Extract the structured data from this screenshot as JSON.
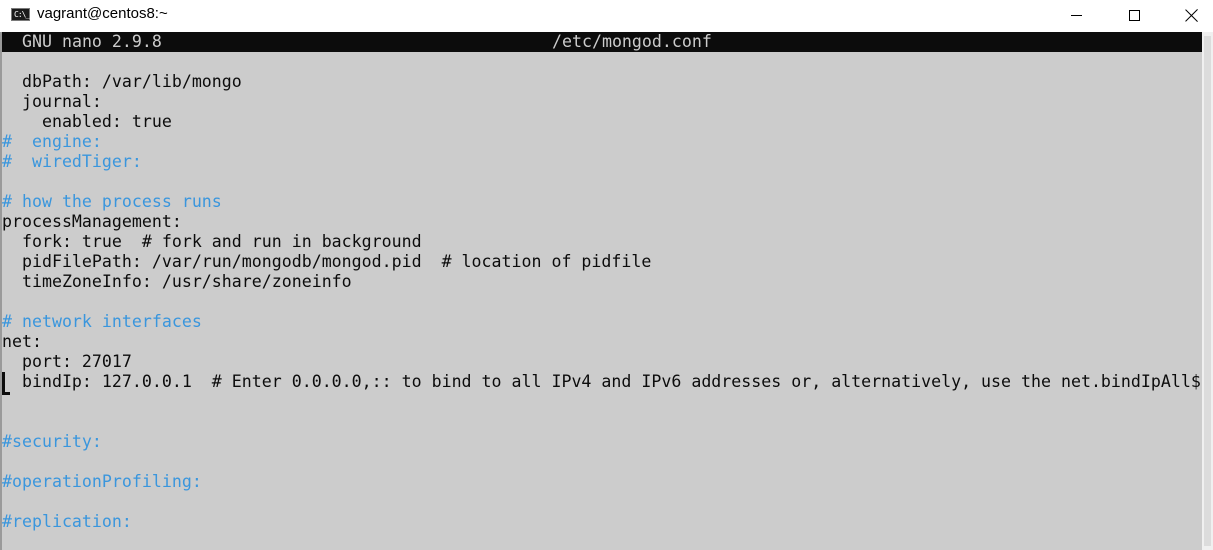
{
  "window": {
    "title": "vagrant@centos8:~",
    "icon": "console-icon",
    "icon_glyph": "C:\\_"
  },
  "nano": {
    "version": "GNU nano 2.9.8",
    "filename": "/etc/mongod.conf"
  },
  "colors": {
    "background": "#cccccc",
    "text": "#0c0c0c",
    "comment": "#3a96dd",
    "header_bg": "#0c0c0c"
  },
  "lines": [
    {
      "text": "  dbPath: /var/lib/mongo",
      "comment": false
    },
    {
      "text": "  journal:",
      "comment": false
    },
    {
      "text": "    enabled: true",
      "comment": false
    },
    {
      "text": "#  engine:",
      "comment": true
    },
    {
      "text": "#  wiredTiger:",
      "comment": true
    },
    {
      "text": "",
      "comment": false
    },
    {
      "text": "# how the process runs",
      "comment": true
    },
    {
      "text": "processManagement:",
      "comment": false
    },
    {
      "text": "  fork: true  # fork and run in background",
      "comment": false
    },
    {
      "text": "  pidFilePath: /var/run/mongodb/mongod.pid  # location of pidfile",
      "comment": false
    },
    {
      "text": "  timeZoneInfo: /usr/share/zoneinfo",
      "comment": false
    },
    {
      "text": "",
      "comment": false
    },
    {
      "text": "# network interfaces",
      "comment": true
    },
    {
      "text": "net:",
      "comment": false
    },
    {
      "text": "  port: 27017",
      "comment": false
    },
    {
      "text": "  bindIp: 127.0.0.1  # Enter 0.0.0.0,:: to bind to all IPv4 and IPv6 addresses or, alternatively, use the net.bindIpAll$",
      "comment": false
    },
    {
      "text": "",
      "comment": false
    },
    {
      "text": "",
      "comment": false
    },
    {
      "text": "#security:",
      "comment": true
    },
    {
      "text": "",
      "comment": false
    },
    {
      "text": "#operationProfiling:",
      "comment": true
    },
    {
      "text": "",
      "comment": false
    },
    {
      "text": "#replication:",
      "comment": true
    }
  ]
}
